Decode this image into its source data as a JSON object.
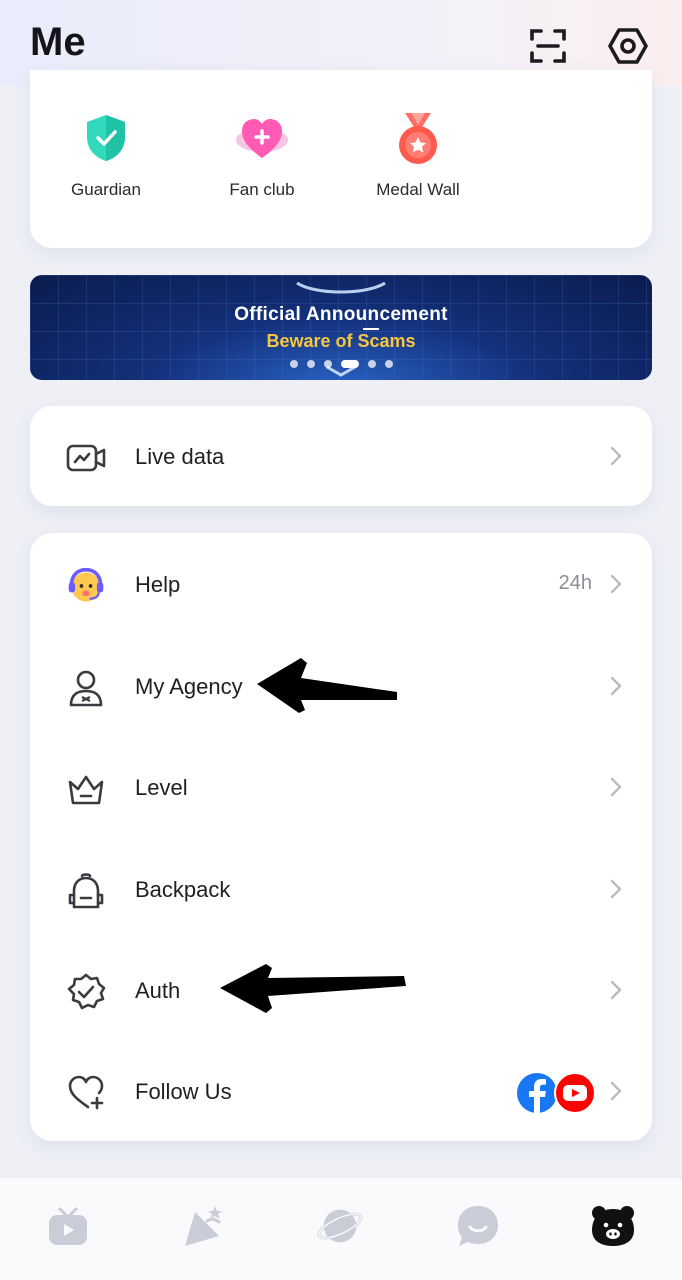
{
  "header": {
    "title": "Me",
    "icons": [
      "scan-icon",
      "settings-icon"
    ]
  },
  "badges": [
    {
      "label": "Guardian",
      "icon": "shield-check-icon",
      "color": "#2fd2b4"
    },
    {
      "label": "Fan club",
      "icon": "heart-plus-icon",
      "color": "#ff5fb8"
    },
    {
      "label": "Medal Wall",
      "icon": "medal-icon",
      "color": "#ff5a4e"
    }
  ],
  "banner": {
    "title": "Official Announcement",
    "subtitle": "Beware of Scams",
    "slide_count": 7,
    "active_slide": 4
  },
  "live": {
    "label": "Live data",
    "icon": "live-chart-icon"
  },
  "menu": [
    {
      "label": "Help",
      "icon": "support-agent-icon",
      "value": "24h"
    },
    {
      "label": "My Agency",
      "icon": "agency-person-icon"
    },
    {
      "label": "Level",
      "icon": "crown-icon"
    },
    {
      "label": "Backpack",
      "icon": "backpack-icon"
    },
    {
      "label": "Auth",
      "icon": "verified-badge-icon"
    },
    {
      "label": "Follow Us",
      "icon": "heart-add-icon",
      "social": [
        "facebook-icon",
        "youtube-icon"
      ]
    }
  ],
  "colors": {
    "accent": "#f6c542",
    "chevron": "#b9bcc4",
    "facebook": "#1877f2",
    "youtube": "#ff0000",
    "arrow": "#000000"
  },
  "bottom_nav": [
    "live-tv-icon",
    "party-icon",
    "planet-icon",
    "chat-icon",
    "profile-icon"
  ],
  "active_tab": 4
}
